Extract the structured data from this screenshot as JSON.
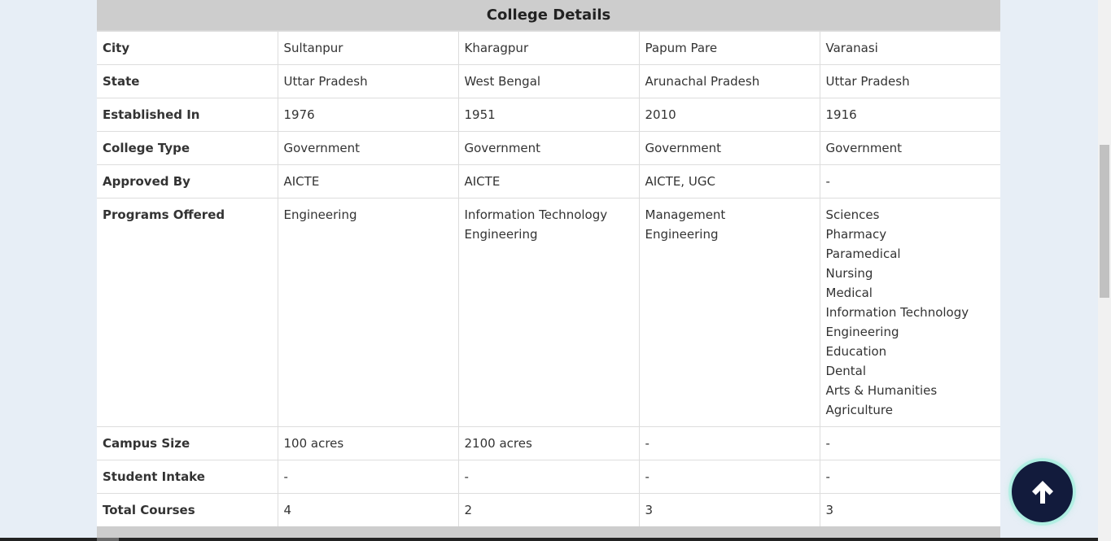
{
  "section_title": "College Details",
  "rows": [
    {
      "label": "City",
      "values": [
        "Sultanpur",
        "Kharagpur",
        "Papum Pare",
        "Varanasi"
      ]
    },
    {
      "label": "State",
      "values": [
        "Uttar Pradesh",
        "West Bengal",
        "Arunachal Pradesh",
        "Uttar Pradesh"
      ]
    },
    {
      "label": "Established In",
      "values": [
        "1976",
        "1951",
        "2010",
        "1916"
      ]
    },
    {
      "label": "College Type",
      "values": [
        "Government",
        "Government",
        "Government",
        "Government"
      ]
    },
    {
      "label": "Approved By",
      "values": [
        "AICTE",
        "AICTE",
        "AICTE, UGC",
        "-"
      ]
    }
  ],
  "programs": {
    "label": "Programs Offered",
    "values": [
      [
        "Engineering"
      ],
      [
        "Information Technology",
        "Engineering"
      ],
      [
        "Management",
        "Engineering"
      ],
      [
        "Sciences",
        "Pharmacy",
        "Paramedical",
        "Nursing",
        "Medical",
        "Information Technology",
        "Engineering",
        "Education",
        "Dental",
        "Arts & Humanities",
        "Agriculture"
      ]
    ]
  },
  "rows_after": [
    {
      "label": "Campus Size",
      "values": [
        "100 acres",
        "2100 acres",
        "-",
        "-"
      ]
    },
    {
      "label": "Student Intake",
      "values": [
        "-",
        "-",
        "-",
        "-"
      ]
    },
    {
      "label": "Total Courses",
      "values": [
        "4",
        "2",
        "3",
        "3"
      ]
    }
  ],
  "back_to_top": {
    "icon": "arrow-up-icon"
  },
  "colors": {
    "page_bg": "#e7eef6",
    "header_bg": "#cdcdcd",
    "button_bg": "#121b3c",
    "button_glow": "#7ef0d2"
  }
}
